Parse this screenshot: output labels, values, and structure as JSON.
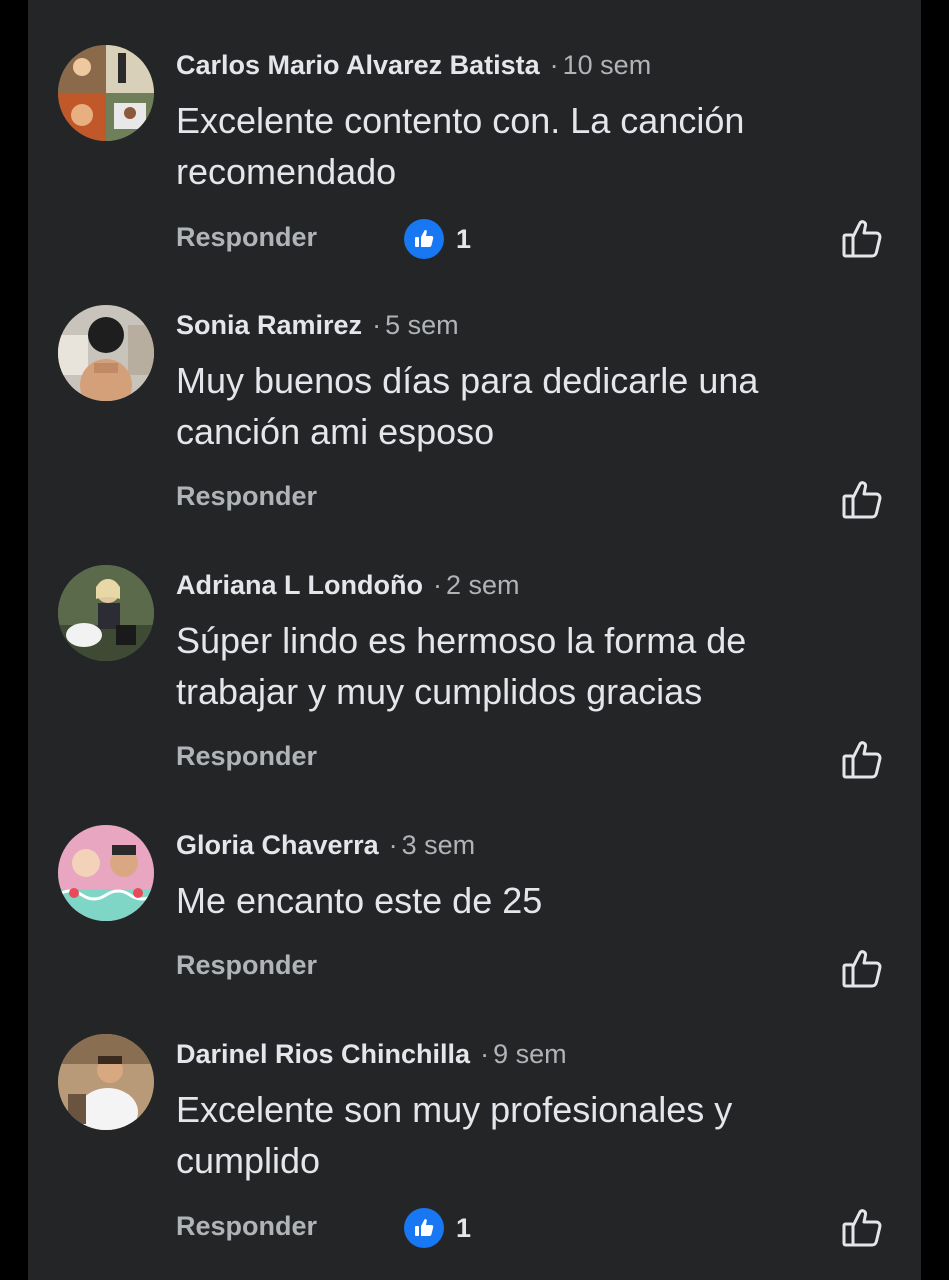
{
  "comments": [
    {
      "author": "Carlos Mario Alvarez Batista",
      "separator": "·",
      "time": "10 sem",
      "text": "Excelente contento con. La canción recomendado",
      "reply_label": "Responder",
      "reaction_count": "1",
      "reaction_icon": "like-icon"
    },
    {
      "author": "Sonia Ramirez",
      "separator": "·",
      "time": "5 sem",
      "text": "Muy buenos días para dedicarle una canción ami esposo",
      "reply_label": "Responder"
    },
    {
      "author": "Adriana L Londoño",
      "separator": "·",
      "time": "2 sem",
      "text": "Súper lindo  es hermoso la forma de trabajar y muy cumplidos gracias",
      "reply_label": "Responder"
    },
    {
      "author": "Gloria Chaverra",
      "separator": "·",
      "time": "3 sem",
      "text": "Me encanto este de 25",
      "reply_label": "Responder"
    },
    {
      "author": "Darinel Rios Chinchilla",
      "separator": "·",
      "time": "9 sem",
      "text": "Excelente son muy profesionales y cumplido",
      "reply_label": "Responder",
      "reaction_count": "1",
      "reaction_icon": "like-icon"
    }
  ],
  "colors": {
    "background": "#242526",
    "outer": "#000000",
    "primary_text": "#e4e6eb",
    "secondary_text": "#b0b3b8",
    "like_blue": "#1877f2"
  }
}
